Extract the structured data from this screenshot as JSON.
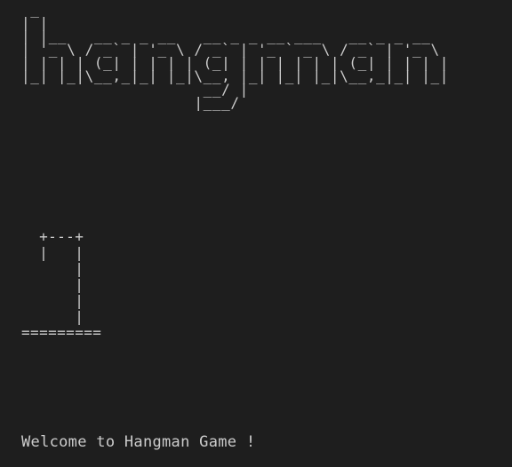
{
  "terminal": {
    "banner_art": " _\n| |\n| |__   __ _ _ __   __ _ _ __ ___   __ _ _ __\n| '_ \\ / _` | '_ \\ / _` | '_ ` _ \\ / _` | '_ \\\n| | | | (_| | | | | (_| | | | | | | (_| | | | |\n|_| |_|\\__,_|_| |_|\\__, |_| |_| |_|\\__,_|_| |_|\n                    __/ |\n                   |___/",
    "gallows_art": "  +---+\n  |   |\n      |\n      |\n      |\n      |\n=========",
    "welcome_message": "Welcome to Hangman Game !"
  },
  "colors": {
    "background": "#1e1e1e",
    "text": "#cccccc"
  }
}
